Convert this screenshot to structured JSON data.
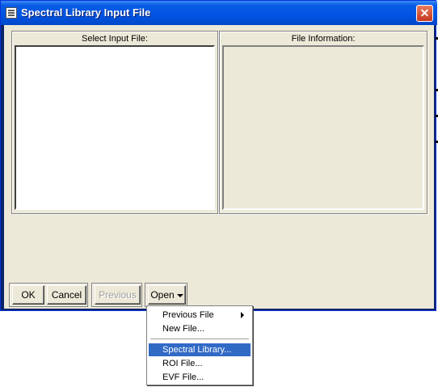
{
  "window": {
    "title": "Spectral Library Input File",
    "close_glyph": "✕"
  },
  "panels": {
    "select_input_label": "Select Input File:",
    "file_info_label": "File Information:"
  },
  "buttons": {
    "ok": "OK",
    "cancel": "Cancel",
    "previous": "Previous",
    "open": "Open"
  },
  "open_menu": {
    "items": [
      {
        "label": "Previous File",
        "has_submenu": true
      },
      {
        "label": "New File..."
      },
      {
        "label": "Spectral Library...",
        "selected": true
      },
      {
        "label": "ROI File..."
      },
      {
        "label": "EVF File..."
      }
    ]
  },
  "colors": {
    "titlebar": "#0054e3",
    "dialog_bg": "#ece9d8",
    "selection": "#316ac5"
  }
}
